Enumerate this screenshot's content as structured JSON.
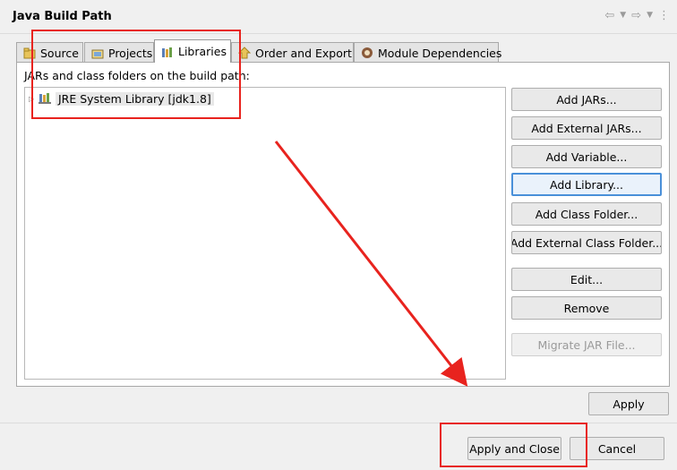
{
  "header": {
    "title": "Java Build Path"
  },
  "tabs": [
    {
      "label": "Source",
      "icon": "source-folder-icon"
    },
    {
      "label": "Projects",
      "icon": "projects-icon"
    },
    {
      "label": "Libraries",
      "icon": "libraries-icon",
      "active": true
    },
    {
      "label": "Order and Export",
      "icon": "order-export-icon"
    },
    {
      "label": "Module Dependencies",
      "icon": "module-icon"
    }
  ],
  "panel": {
    "label": "JARs and class folders on the build path:",
    "tree": [
      {
        "label": "JRE System Library [jdk1.8]",
        "icon": "library-icon",
        "expanded": false
      }
    ]
  },
  "buttons": {
    "add_jars": "Add JARs...",
    "add_external_jars": "Add External JARs...",
    "add_variable": "Add Variable...",
    "add_library": "Add Library...",
    "add_class_folder": "Add Class Folder...",
    "add_external_class_folder": "Add External Class Folder...",
    "edit": "Edit...",
    "remove": "Remove",
    "migrate_jar": "Migrate JAR File..."
  },
  "footer": {
    "apply": "Apply",
    "apply_close": "Apply and Close",
    "cancel": "Cancel"
  },
  "colors": {
    "annotation_red": "#e8231e",
    "focus_blue": "#4a90d9"
  }
}
